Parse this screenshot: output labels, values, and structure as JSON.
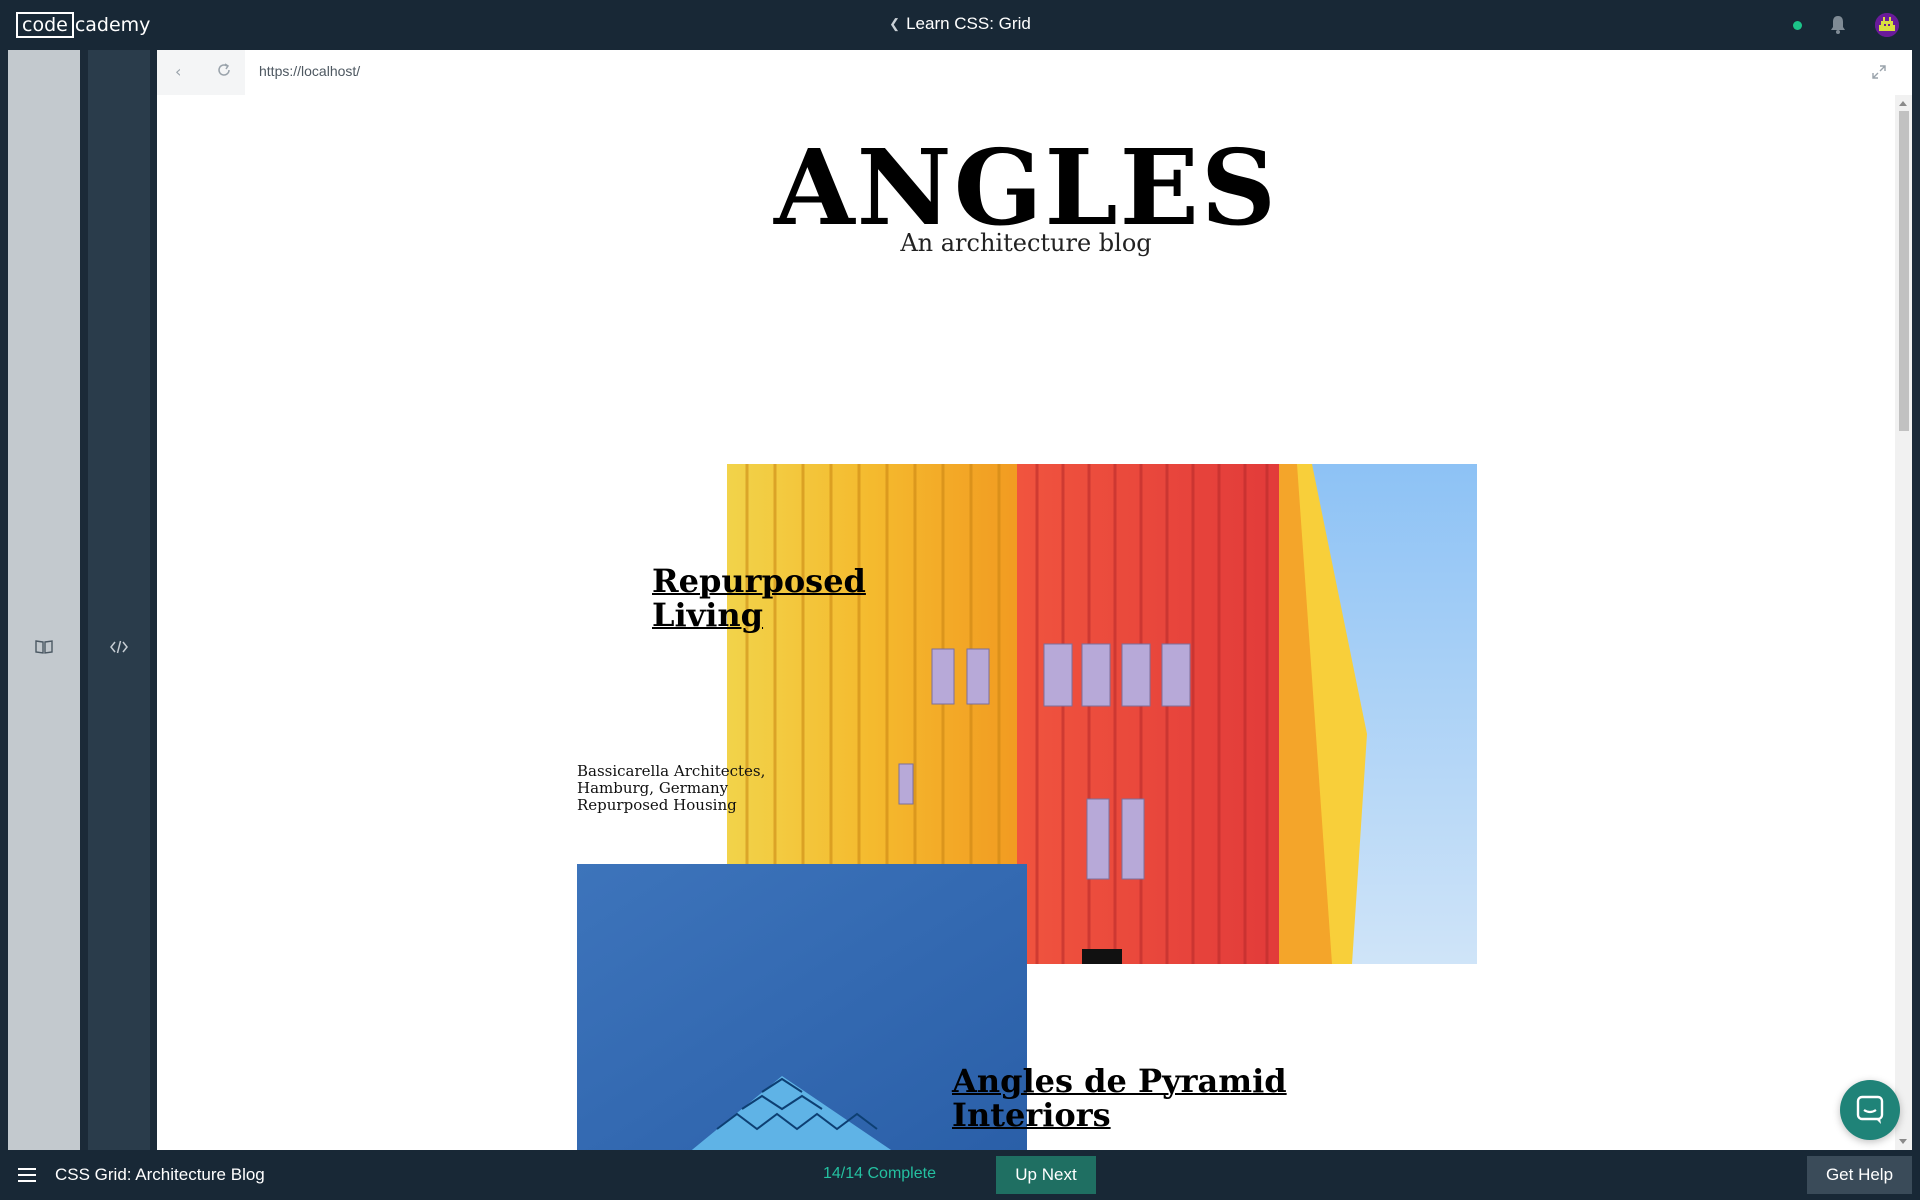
{
  "topbar": {
    "logo_code": "code",
    "logo_rest": "cademy",
    "course_title": "Learn CSS: Grid",
    "status_color": "#1cc489"
  },
  "side_panels": {
    "learn_icon": "book-icon",
    "code_icon": "code-brackets-icon"
  },
  "browser": {
    "url": "https://localhost/",
    "back_icon": "chevron-left-icon",
    "reload_icon": "reload-icon",
    "expand_icon": "expand-icon"
  },
  "page": {
    "site_title": "ANGLES",
    "site_subtitle": "An architecture blog",
    "posts": [
      {
        "title": "Repurposed Living",
        "meta": [
          "Bassicarella Architectes,",
          "Hamburg, Germany",
          "Repurposed Housing"
        ]
      },
      {
        "title": "Angles de Pyramid Interiors"
      }
    ]
  },
  "bottombar": {
    "lesson_title": "CSS Grid: Architecture Blog",
    "progress": "14/14 Complete",
    "up_next_label": "Up Next",
    "get_help_label": "Get Help"
  },
  "colors": {
    "topbar_bg": "#182836",
    "progress_accent": "#24c0a0",
    "up_next_bg": "#1f6f62",
    "chat_bubble_bg": "#1f8378"
  }
}
